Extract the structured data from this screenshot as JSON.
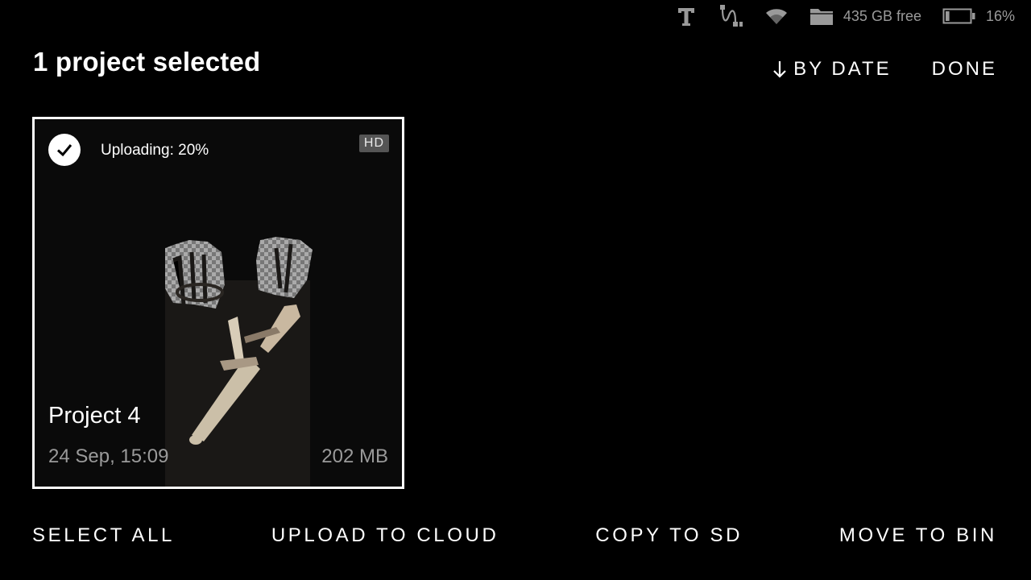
{
  "status_bar": {
    "icons": [
      "text-t-icon",
      "usb-cable-icon",
      "wifi-icon",
      "folder-icon",
      "battery-icon"
    ],
    "storage_free": "435 GB free",
    "battery_level": "16%"
  },
  "header": {
    "title": "1 project selected",
    "sort_label": "BY DATE",
    "done_label": "DONE"
  },
  "project": {
    "upload_status": "Uploading: 20%",
    "quality_badge": "HD",
    "name": "Project 4",
    "date": "24 Sep, 15:09",
    "size": "202 MB",
    "selected": true
  },
  "bottom_actions": {
    "select_all": "SELECT ALL",
    "upload_to_cloud": "UPLOAD TO CLOUD",
    "copy_to_sd": "COPY TO SD",
    "move_to_bin": "MOVE TO BIN"
  },
  "colors": {
    "background": "#000000",
    "text": "#ffffff",
    "muted_text": "#9a9a9a",
    "badge_bg": "#555555"
  }
}
